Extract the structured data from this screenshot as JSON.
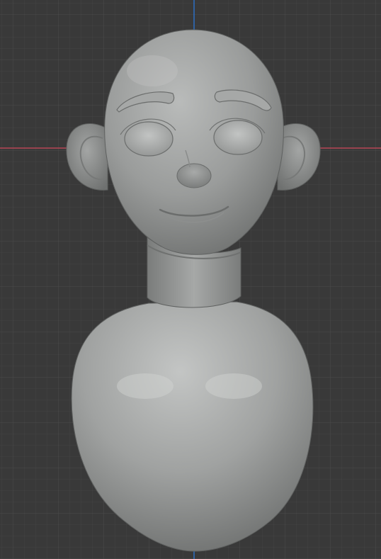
{
  "viewport": {
    "background": "#393939",
    "grid_minor_color": "#444444",
    "grid_major_color": "#4f4f4f",
    "x_axis_color": "#c24a5a",
    "y_axis_color": "#2c6fc4",
    "grid_visible": true
  },
  "model": {
    "description_icon": "clay-bust-model-icon",
    "material_base": "#9c9e9d",
    "material_light": "#cfd1d0",
    "material_shadow": "#5c5e5d"
  }
}
